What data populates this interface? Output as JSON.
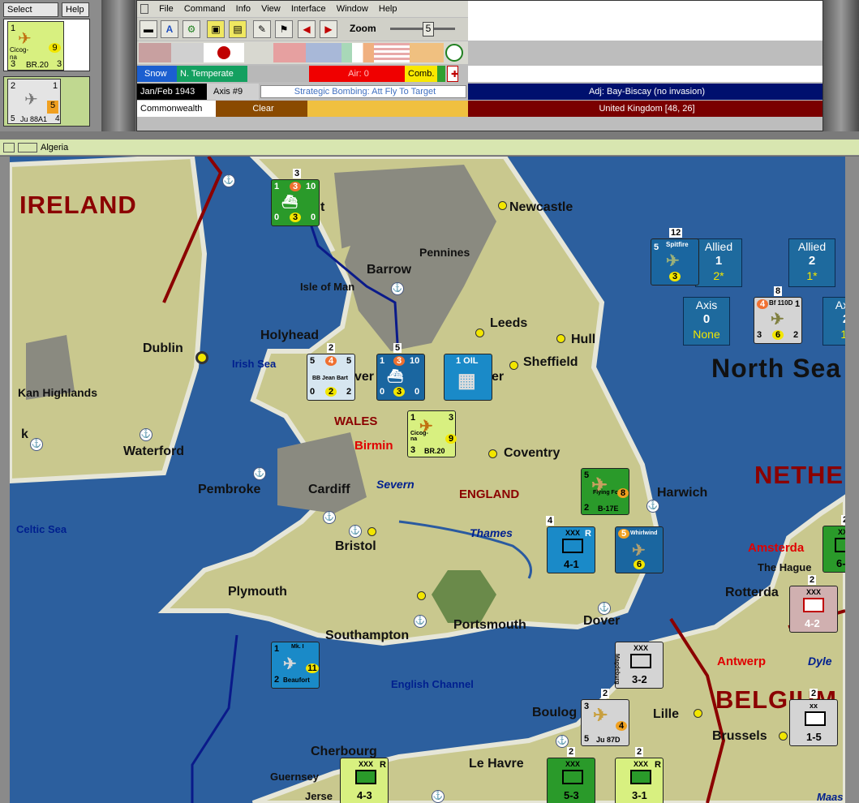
{
  "side_panel": {
    "select_label": "Select",
    "help_label": "Help",
    "slot1": {
      "top_left": "1",
      "name": "Cicog-na",
      "model": "BR.20",
      "left_val": "3",
      "right_val": "3",
      "strength": "9"
    },
    "slot2": {
      "top_left": "2",
      "top_right": "1",
      "model": "Ju 88A1",
      "left_val": "5",
      "right_val": "4",
      "strength": "5"
    }
  },
  "menu": [
    "File",
    "Command",
    "Info",
    "View",
    "Interface",
    "Window",
    "Help"
  ],
  "toolbar": {
    "zoom_label": "Zoom",
    "zoom_value": "5"
  },
  "status": {
    "weather": "Snow",
    "zone": "N. Temperate",
    "air": "Air: 0",
    "comb": "Comb.",
    "date": "Jan/Feb 1943",
    "turn": "Axis #9",
    "action": "Strategic Bombing: Att Fly To Target",
    "adjacent": "Adj: Bay-Biscay (no invasion)",
    "faction": "Commonwealth",
    "condition": "Clear",
    "location": "United Kingdom [48, 26]"
  },
  "window_title": "Algeria",
  "map": {
    "countries": {
      "ireland": "IRELAND",
      "north_sea": "North Sea",
      "netherlands": "NETHE",
      "belgium": "BELGIUM"
    },
    "regions": {
      "wales": "WALES",
      "england": "ENGLAND",
      "birmingham": "Birmin",
      "amsterdam": "Amsterda",
      "antwerp": "Antwerp"
    },
    "cities": {
      "newcastle": "Newcastle",
      "barrow": "Barrow",
      "pennines": "Pennines",
      "isle_of_man": "Isle of Man",
      "leeds": "Leeds",
      "hull": "Hull",
      "holyhead": "Holyhead",
      "dublin": "Dublin",
      "sheffield": "Sheffield",
      "highlands": "Kan Highlands",
      "waterford": "Waterford",
      "coventry": "Coventry",
      "pembroke": "Pembroke",
      "cardiff": "Cardiff",
      "harwich": "Harwich",
      "bristol": "Bristol",
      "plymouth": "Plymouth",
      "southampton": "Southampton",
      "portsmouth": "Portsmouth",
      "dover": "Dover",
      "the_hague": "The Hague",
      "rotterdam": "Rotterda",
      "boulogne": "Boulog",
      "lille": "Lille",
      "brussels": "Brussels",
      "cherbourg": "Cherbourg",
      "le_havre": "Le Havre",
      "guernsey": "Guernsey",
      "jersey": "Jerse",
      "manchester_frag": "Ma",
      "manchester_end": "er",
      "liverpool_frag": "ver",
      "belfast_frag": "t",
      "k_frag": "k"
    },
    "seas": {
      "irish_sea": "Irish Sea",
      "celtic_sea": "Celtic Sea",
      "english_channel": "English Channel",
      "severn": "Severn",
      "thames": "Thames",
      "dyle": "Dyle",
      "maas": "Maas"
    },
    "boxes": {
      "allied1": {
        "title": "Allied",
        "value": "1",
        "sub": "2*"
      },
      "allied2": {
        "title": "Allied",
        "value": "2",
        "sub": "1*"
      },
      "axis0": {
        "title": "Axis",
        "value": "0",
        "sub": "None"
      },
      "axis2": {
        "title": "Axis",
        "value": "2",
        "sub": "1*"
      }
    },
    "units": {
      "fleet_green": {
        "stack": "3",
        "a": "1",
        "b": "3",
        "c": "10",
        "d": "0",
        "e": "3",
        "f": "0"
      },
      "fleet_bb": {
        "stack": "2",
        "a": "5",
        "b": "4",
        "c": "5",
        "name": "BB Jean Bart",
        "d": "0",
        "e": "2",
        "f": "2"
      },
      "fleet_blue": {
        "stack": "5",
        "a": "1",
        "b": "3",
        "c": "10",
        "d": "0",
        "e": "3",
        "f": "0"
      },
      "oil": {
        "label": "1 OIL"
      },
      "cicogna": {
        "a": "1",
        "b": "3",
        "name": "Cicog-na",
        "model": "BR.20",
        "c": "3",
        "d": "9"
      },
      "spitfire": {
        "stack": "12",
        "a": "5",
        "name": "Spitfire",
        "b": "3"
      },
      "bf110": {
        "stack": "8",
        "a": "4",
        "name": "Bf 110D",
        "b": "1",
        "c": "3",
        "d": "6",
        "e": "2"
      },
      "flying_fort": {
        "stack": "2",
        "a": "5",
        "name": "Flying Fort",
        "model": "B-17E",
        "b": "2",
        "c": "8"
      },
      "xlv_corps": {
        "stack": "4",
        "corps": "XXX",
        "side": "XLV Corr",
        "r": "R",
        "val": "4-1"
      },
      "whirlwind": {
        "a": "5",
        "name": "Whirlwind",
        "b": "6"
      },
      "beaufort": {
        "a": "1",
        "name": "Mk. I",
        "b": "2",
        "model": "Beaufort",
        "c": "11"
      },
      "xxxvi_corps": {
        "stack": "2",
        "corps": "XXX",
        "val": "6-3"
      },
      "dutch": {
        "stack": "2",
        "corps": "XXX",
        "val": "4-2"
      },
      "magdeburg": {
        "corps": "XXX",
        "val": "3-2",
        "side": "Magdeburg"
      },
      "ju87": {
        "stack": "2",
        "a": "3",
        "model": "Ju 87D",
        "b": "5",
        "c": "4"
      },
      "tank": {
        "stack": "2",
        "corps": "xx",
        "val": "1-5"
      },
      "mech": {
        "corps": "XXX",
        "val": "4-3",
        "r": "R"
      },
      "inf": {
        "stack": "2",
        "corps": "XXX",
        "val": "5-3"
      },
      "xiii": {
        "stack": "2",
        "corps": "XXX",
        "val": "3-1",
        "r": "R"
      }
    }
  },
  "colors": {
    "sea": "#2c5f9e",
    "land": "#c9c88e",
    "allied_blue": "#1a66a0",
    "axis_grey": "#d4d4d4",
    "green": "#2a9a2a",
    "yellow_green": "#d8f080",
    "border_red": "#8b0000"
  }
}
